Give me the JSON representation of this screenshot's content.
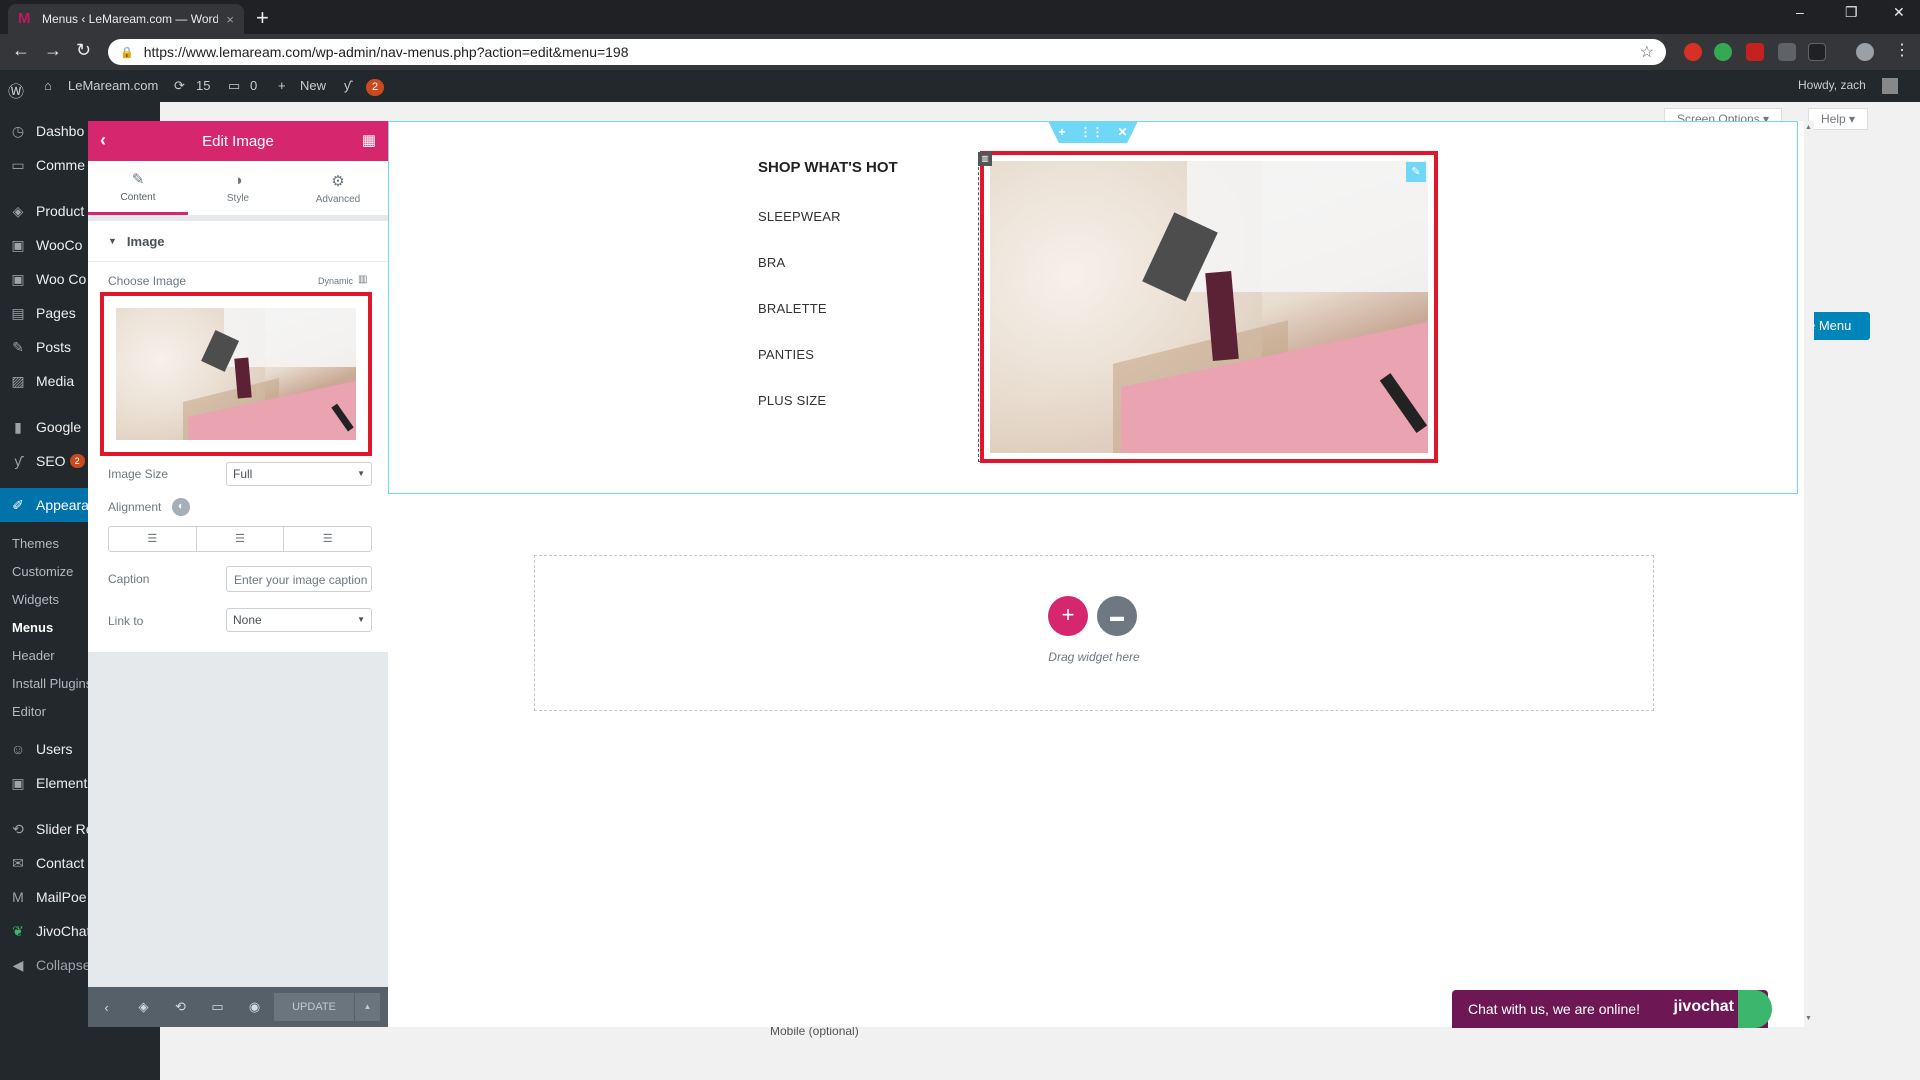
{
  "browser": {
    "tab_title": "Menus ‹ LeMaream.com — Word",
    "tab_close": "×",
    "new_tab": "+",
    "url": "https://www.lemaream.com/wp-admin/nav-menus.php?action=edit&menu=198",
    "controls": {
      "minimize": "–",
      "restore": "❐",
      "close": "✕"
    }
  },
  "adminbar": {
    "site": "LeMaream.com",
    "updates": "15",
    "comments": "0",
    "new": "New",
    "yoast_count": "2",
    "howdy": "Howdy, zach"
  },
  "wp_sidebar": {
    "items": [
      {
        "label": "Dashbo",
        "icon": "dashboard-icon"
      },
      {
        "label": "Comme",
        "icon": "comments-icon"
      },
      {
        "label": "Product",
        "icon": "products-icon"
      },
      {
        "label": "WooCo",
        "icon": "woo-icon"
      },
      {
        "label": "Woo Co",
        "icon": "woo-icon"
      },
      {
        "label": "Pages",
        "icon": "pages-icon"
      },
      {
        "label": "Posts",
        "icon": "posts-icon"
      },
      {
        "label": "Media",
        "icon": "media-icon"
      },
      {
        "label": "Google",
        "icon": "google-icon"
      },
      {
        "label": "SEO",
        "icon": "seo-icon",
        "badge": "2"
      },
      {
        "label": "Appeara",
        "icon": "appearance-icon"
      },
      {
        "label": "Users",
        "icon": "users-icon"
      },
      {
        "label": "Element",
        "icon": "elementor-icon"
      },
      {
        "label": "Slider Re",
        "icon": "slider-icon"
      },
      {
        "label": "Contact",
        "icon": "contact-icon"
      },
      {
        "label": "MailPoe",
        "icon": "mailpoet-icon"
      },
      {
        "label": "JivoChat",
        "icon": "jivochat-icon"
      },
      {
        "label": "Collapse",
        "icon": "collapse-icon"
      }
    ],
    "sub_items": [
      "Themes",
      "Customize",
      "Widgets",
      "Menus",
      "Header",
      "Install Plugins",
      "Editor"
    ]
  },
  "wp_page": {
    "screen_options": "Screen Options ▾",
    "help": "Help ▾",
    "save_menu": "e Menu",
    "mobile_option": "Mobile (optional)"
  },
  "panel": {
    "title": "Edit Image",
    "tabs": [
      {
        "label": "Content",
        "icon": "pencil-icon"
      },
      {
        "label": "Style",
        "icon": "contrast-icon"
      },
      {
        "label": "Advanced",
        "icon": "gear-icon"
      }
    ],
    "section": "Image",
    "choose_image_label": "Choose Image",
    "dynamic_label": "Dynamic",
    "image_size_label": "Image Size",
    "image_size_value": "Full",
    "alignment_label": "Alignment",
    "caption_label": "Caption",
    "caption_placeholder": "Enter your image caption",
    "link_label": "Link to",
    "link_value": "None",
    "update_label": "UPDATE"
  },
  "preview": {
    "shop_title": "SHOP WHAT'S HOT",
    "menu_links": [
      "SLEEPWEAR",
      "BRA",
      "BRALETTE",
      "PANTIES",
      "PLUS SIZE"
    ],
    "drag_text": "Drag widget here"
  },
  "jivochat": {
    "message": "Chat with us, we are online!",
    "brand": "jivochat"
  }
}
